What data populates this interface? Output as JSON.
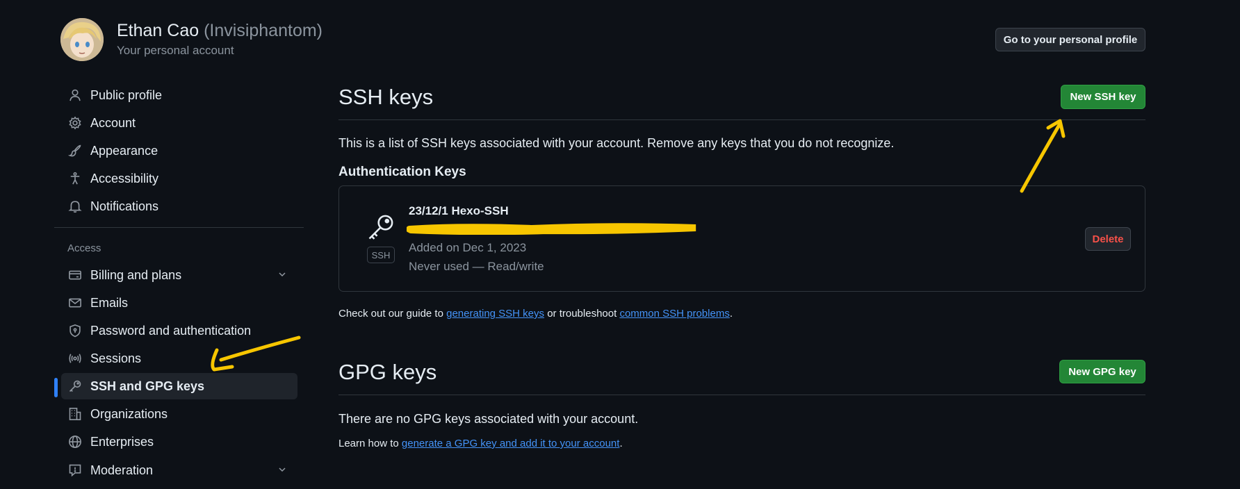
{
  "header": {
    "display_name": "Ethan Cao",
    "handle": "(Invisiphantom)",
    "subtitle": "Your personal account",
    "profile_button": "Go to your personal profile"
  },
  "sidebar": {
    "items": [
      {
        "label": "Public profile",
        "icon": "person-icon"
      },
      {
        "label": "Account",
        "icon": "gear-icon"
      },
      {
        "label": "Appearance",
        "icon": "paintbrush-icon"
      },
      {
        "label": "Accessibility",
        "icon": "accessibility-icon"
      },
      {
        "label": "Notifications",
        "icon": "bell-icon"
      }
    ],
    "section_label": "Access",
    "access_items": [
      {
        "label": "Billing and plans",
        "icon": "credit-card-icon",
        "expandable": true
      },
      {
        "label": "Emails",
        "icon": "mail-icon"
      },
      {
        "label": "Password and authentication",
        "icon": "shield-lock-icon"
      },
      {
        "label": "Sessions",
        "icon": "broadcast-icon"
      },
      {
        "label": "SSH and GPG keys",
        "icon": "key-icon",
        "active": true
      },
      {
        "label": "Organizations",
        "icon": "organization-icon"
      },
      {
        "label": "Enterprises",
        "icon": "globe-icon"
      },
      {
        "label": "Moderation",
        "icon": "report-icon",
        "expandable": true
      }
    ]
  },
  "ssh": {
    "title": "SSH keys",
    "new_button": "New SSH key",
    "description": "This is a list of SSH keys associated with your account. Remove any keys that you do not recognize.",
    "auth_heading": "Authentication Keys",
    "key": {
      "title": "23/12/1 Hexo-SSH",
      "badge": "SSH",
      "added": "Added on Dec 1, 2023",
      "usage": "Never used — Read/write",
      "delete_label": "Delete"
    },
    "guide": {
      "prefix": "Check out our guide to ",
      "link1": "generating SSH keys",
      "middle": " or troubleshoot ",
      "link2": "common SSH problems",
      "suffix": "."
    }
  },
  "gpg": {
    "title": "GPG keys",
    "new_button": "New GPG key",
    "empty_text": "There are no GPG keys associated with your account.",
    "learn": {
      "prefix": "Learn how to ",
      "link": "generate a GPG key and add it to your account",
      "suffix": "."
    }
  },
  "colors": {
    "background": "#0d1117",
    "accent_green": "#238636",
    "link": "#4493f8",
    "danger": "#f85149",
    "annotation": "#f7c600"
  }
}
